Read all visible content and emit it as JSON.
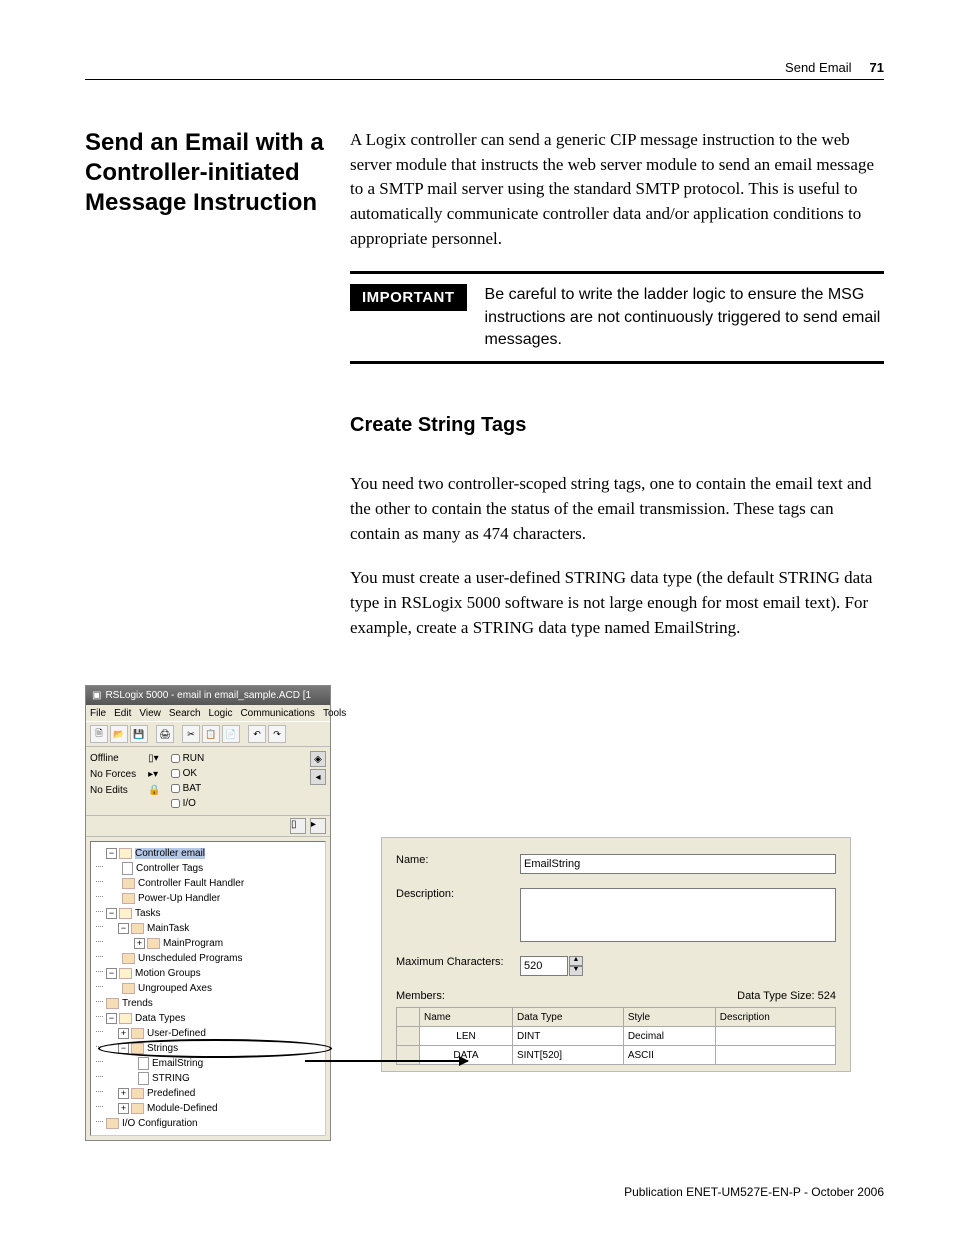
{
  "header": {
    "section": "Send Email",
    "page_num": "71"
  },
  "section_title": "Send an Email with a Controller-initiated Message Instruction",
  "intro_p": "A Logix controller can send a generic CIP message instruction to the web server module that instructs the web server module to send an email message to a SMTP mail server using the standard SMTP protocol. This is useful to automatically communicate controller data and/or application conditions to appropriate personnel.",
  "important": {
    "label": "IMPORTANT",
    "text": "Be careful to write the ladder logic to ensure the MSG instructions are not continuously triggered to send email messages."
  },
  "subsection_title": "Create String Tags",
  "p2": "You need two controller-scoped string tags, one to contain the email text and the other to contain the status of the email transmission. These tags can contain as many as 474 characters.",
  "p3": "You must create a user-defined STRING data type (the default STRING data type in RSLogix 5000 software is not large enough for most email text). For example, create a STRING data type named EmailString.",
  "app": {
    "title": "RSLogix 5000 - email in email_sample.ACD [1",
    "menus": [
      "File",
      "Edit",
      "View",
      "Search",
      "Logic",
      "Communications",
      "Tools"
    ],
    "status": {
      "offline": "Offline",
      "no_forces": "No Forces",
      "no_edits": "No Edits",
      "run": "RUN",
      "ok": "OK",
      "bat": "BAT",
      "io": "I/O"
    },
    "tree": {
      "controller": "Controller email",
      "controller_tags": "Controller Tags",
      "fault_handler": "Controller Fault Handler",
      "powerup": "Power-Up Handler",
      "tasks": "Tasks",
      "maintask": "MainTask",
      "mainprogram": "MainProgram",
      "unscheduled": "Unscheduled Programs",
      "motion": "Motion Groups",
      "ungrouped": "Ungrouped Axes",
      "trends": "Trends",
      "datatypes": "Data Types",
      "userdefined": "User-Defined",
      "strings": "Strings",
      "emailstring": "EmailString",
      "stringt": "STRING",
      "predefined": "Predefined",
      "moduledef": "Module-Defined",
      "ioconfig": "I/O Configuration"
    }
  },
  "dialog": {
    "name_label": "Name:",
    "name_value": "EmailString",
    "desc_label": "Description:",
    "desc_value": "",
    "maxchars_label": "Maximum Characters:",
    "maxchars_value": "520",
    "members_label": "Members:",
    "datasize_label": "Data Type Size: 524",
    "cols": {
      "name": "Name",
      "datatype": "Data Type",
      "style": "Style",
      "desc": "Description"
    },
    "rows": [
      {
        "name": "LEN",
        "datatype": "DINT",
        "style": "Decimal",
        "desc": ""
      },
      {
        "name": "DATA",
        "datatype": "SINT[520]",
        "style": "ASCII",
        "desc": ""
      }
    ]
  },
  "footer": "Publication ENET-UM527E-EN-P - October 2006"
}
